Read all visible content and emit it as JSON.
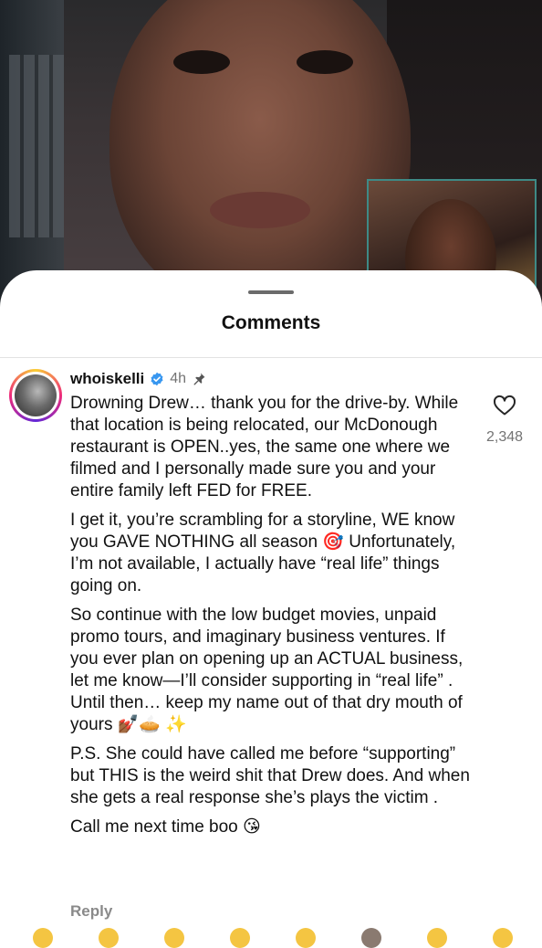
{
  "sheet": {
    "title": "Comments"
  },
  "comment": {
    "username": "whoiskelli",
    "time": "4h",
    "verified": true,
    "pinned": true,
    "paragraphs": [
      "Drowning  Drew… thank you for the drive-by. While that location is being relocated, our McDonough restaurant is OPEN..yes, the same one where we filmed and I personally made sure you and your entire family left FED for FREE.",
      "I get it, you’re scrambling for a storyline, WE know you GAVE NOTHING all season 🎯 Unfortunately, I’m not available, I actually have “real life” things going on.",
      "So continue with the low budget movies, unpaid promo tours, and imaginary business ventures. If you ever plan on opening up an ACTUAL business, let me know—I’ll consider supporting in “real life” . Until then… keep my name out of that dry mouth of yours 💅🏾🥧 ✨",
      "P.S. She could have called me before “supporting” but THIS is the weird shit that Drew does. And when she gets a real response she’s plays the victim .",
      "Call me next time boo 😘"
    ],
    "likes": "2,348",
    "reply_label": "Reply"
  },
  "colors": {
    "verified": "#3897f0",
    "secondary_text": "#737373"
  },
  "icons": {
    "like": "heart-outline-icon",
    "verified": "verified-badge-icon",
    "pin": "pin-icon"
  }
}
